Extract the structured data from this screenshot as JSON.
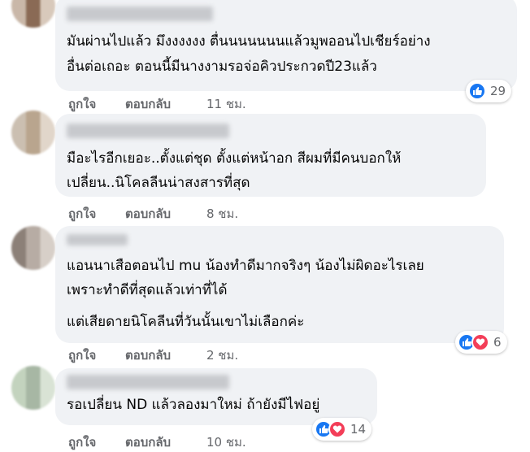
{
  "comments": [
    {
      "lines": [
        "มันผ่านไปแล้ว มึงงงงงง ตื่นนนนนนนแล้วมูพออนไปเชียร์อย่าง",
        "อื่นต่อเถอะ ตอนนี้มีนางงามรอจ่อคิวประกวดปี23แล้ว"
      ],
      "reaction_count": "29",
      "like_label": "ถูกใจ",
      "reply_label": "ตอบกลับ",
      "time": "11 ชม."
    },
    {
      "lines": [
        "มือะไรอีกเยอะ..ตั้งแต่ชุด ตั้งแต่หน้าอก สีผมที่มีคนบอกให้",
        "เปลี่ยน..นิโคลลีนน่าสงสารที่สุด"
      ],
      "like_label": "ถูกใจ",
      "reply_label": "ตอบกลับ",
      "time": "8 ชม."
    },
    {
      "lines": [
        "แอนนาเสือตอนไป mu น้องทำดีมากจริงๆ น้องไม่ผิดอะไรเลย",
        "เพราะทำดีที่สุดแล้วเท่าที่ได้",
        "แต่เสียดายนิโคลีนที่วันนั้นเขาไม่เลือกค่ะ"
      ],
      "reaction_count": "6",
      "like_label": "ถูกใจ",
      "reply_label": "ตอบกลับ",
      "time": "2 ชม."
    },
    {
      "lines": [
        "รอเปลี่ยน ND แล้วลองมาใหม่ ถ้ายังมีไฟอยู่"
      ],
      "reaction_count": "14",
      "like_label": "ถูกใจ",
      "reply_label": "ตอบกลับ",
      "time": "10 ชม."
    }
  ],
  "colors": {
    "bubble": "#f0f2f5",
    "like": "#1877f2",
    "love": "#f33e58",
    "meta": "#65676b"
  }
}
